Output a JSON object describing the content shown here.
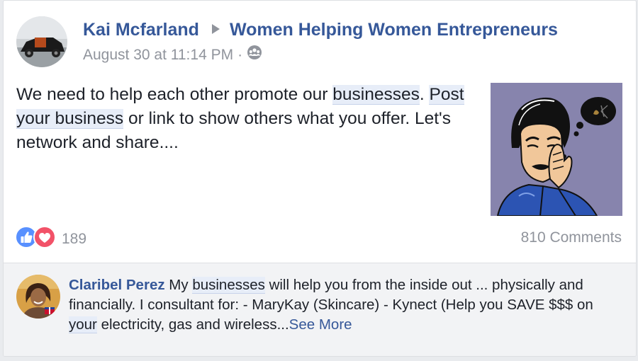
{
  "post": {
    "author": "Kai Mcfarland",
    "group": "Women Helping Women Entrepreneurs",
    "timestamp": "August 30 at 11:14 PM",
    "separator": "·",
    "audience_icon": "group-audience-icon",
    "text_1": "We need to help each other promote our ",
    "text_hl_1": "businesses",
    "text_2": ". ",
    "text_hl_2": "Post your business",
    "text_3": " or link to show others what you offer. Let's network and share....",
    "reaction_count": "189",
    "reaction_icons": [
      "like-icon",
      "love-icon"
    ],
    "comments_label": "810 Comments"
  },
  "comment": {
    "author": "Claribel Perez",
    "text_1": " My ",
    "text_hl_1": "businesses",
    "text_2": " will help you from the inside out ... physically and financially. I consultant for: - MaryKay (Skincare) - Kynect (Help you SAVE $$$ on ",
    "text_hl_2": "your",
    "text_3": " electricity, gas and wireless...",
    "see_more": "See More"
  },
  "colors": {
    "link": "#365899",
    "meta": "#90949c",
    "text": "#1d2129",
    "like": "#5890ff",
    "love": "#f25268",
    "thumb_bg": "#8784ad"
  }
}
